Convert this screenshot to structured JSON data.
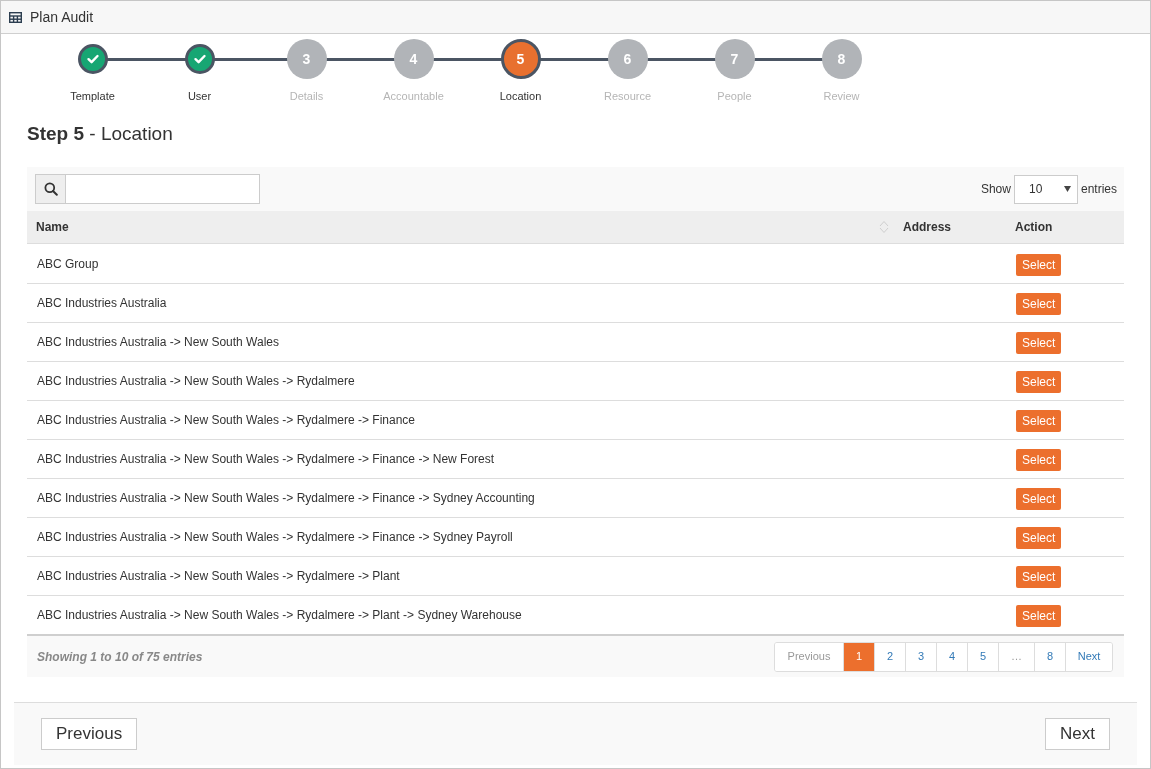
{
  "window": {
    "title": "Plan Audit"
  },
  "steps": [
    {
      "label": "Template",
      "completed": true,
      "selected": false
    },
    {
      "label": "User",
      "completed": true,
      "selected": false
    },
    {
      "number": "3",
      "label": "Details",
      "completed": false,
      "selected": false
    },
    {
      "number": "4",
      "label": "Accountable",
      "completed": false,
      "selected": false
    },
    {
      "number": "5",
      "label": "Location",
      "completed": false,
      "selected": true
    },
    {
      "number": "6",
      "label": "Resource",
      "completed": false,
      "selected": false
    },
    {
      "number": "7",
      "label": "People",
      "completed": false,
      "selected": false
    },
    {
      "number": "8",
      "label": "Review",
      "completed": false,
      "selected": false
    }
  ],
  "heading": "**Step 5** - Location",
  "table": {
    "length_menu": {
      "label": "Show",
      "value": "10",
      "suffix": "entries"
    },
    "columns": [
      {
        "label": "Name",
        "sortable": true
      },
      {
        "label": "Address"
      },
      {
        "label": "Action"
      }
    ],
    "rows": [
      {
        "name": "ABC Group",
        "action": "Select"
      },
      {
        "name": "ABC Industries Australia",
        "action": "Select"
      },
      {
        "name": "ABC Industries Australia -> New South Wales",
        "action": "Select"
      },
      {
        "name": "ABC Industries Australia -> New South Wales -> Rydalmere",
        "action": "Select"
      },
      {
        "name": "ABC Industries Australia -> New South Wales -> Rydalmere -> Finance",
        "action": "Select"
      },
      {
        "name": "ABC Industries Australia -> New South Wales -> Rydalmere -> Finance -> New Forest",
        "action": "Select"
      },
      {
        "name": "ABC Industries Australia -> New South Wales -> Rydalmere -> Finance -> Sydney Accounting",
        "action": "Select"
      },
      {
        "name": "ABC Industries Australia -> New South Wales -> Rydalmere -> Finance -> Sydney Payroll",
        "action": "Select"
      },
      {
        "name": "ABC Industries Australia -> New South Wales -> Rydalmere -> Plant",
        "action": "Select"
      },
      {
        "name": "ABC Industries Australia -> New South Wales -> Rydalmere -> Plant -> Sydney Warehouse",
        "action": "Select"
      }
    ],
    "info": "Showing 1 to 10 of 75 entries",
    "pagination": [
      {
        "label": "Previous",
        "selected": false,
        "disabled": true
      },
      {
        "label": "1",
        "selected": true,
        "disabled": false
      },
      {
        "label": "2",
        "selected": false,
        "disabled": false
      },
      {
        "label": "3",
        "selected": false,
        "disabled": false
      },
      {
        "label": "4",
        "selected": false,
        "disabled": false
      },
      {
        "label": "5",
        "selected": false,
        "disabled": false
      },
      {
        "label": "…",
        "selected": false,
        "disabled": true
      },
      {
        "label": "8",
        "selected": false,
        "disabled": false
      },
      {
        "label": "Next",
        "selected": false,
        "disabled": false
      }
    ]
  },
  "footer": {
    "previous": "Previous",
    "next": "Next"
  }
}
